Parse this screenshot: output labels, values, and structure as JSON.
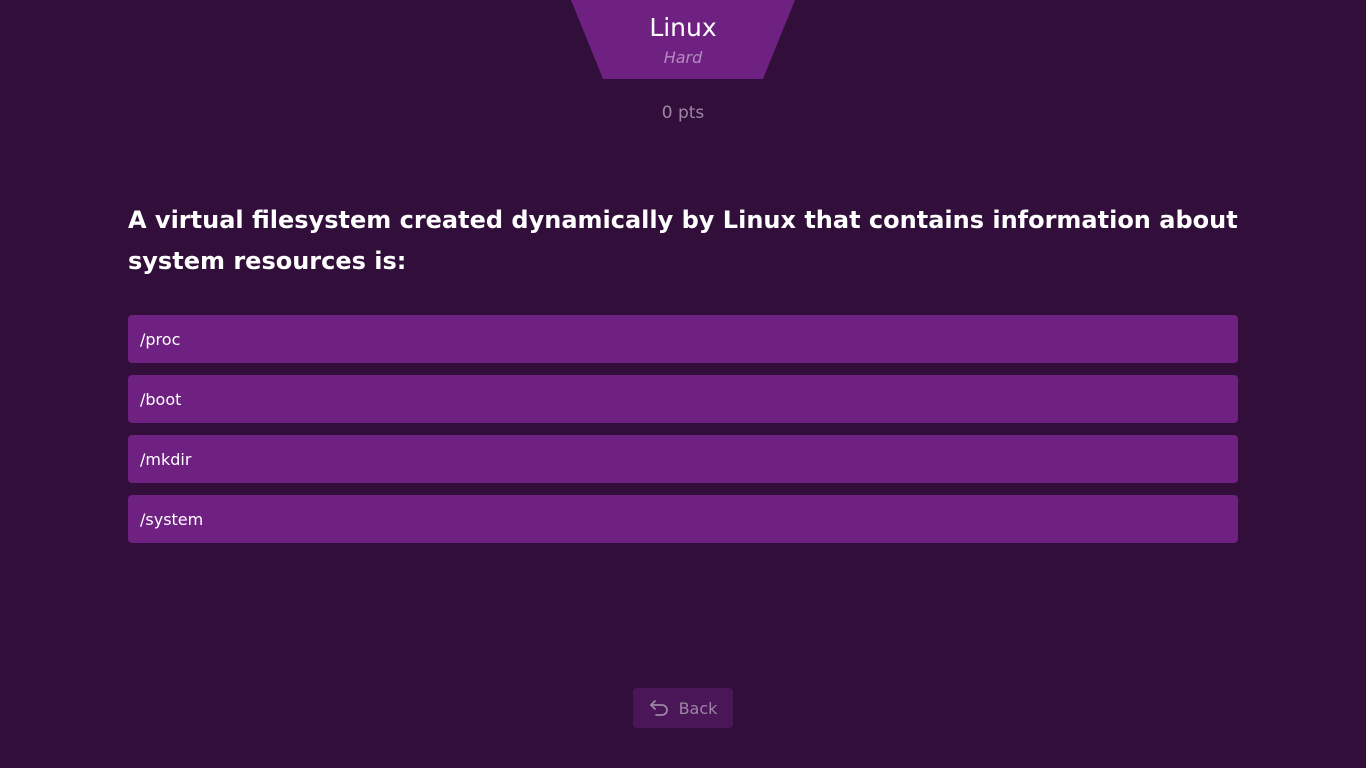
{
  "header": {
    "category": "Linux",
    "difficulty": "Hard"
  },
  "score": {
    "text": "0 pts"
  },
  "question": {
    "text": "A virtual filesystem created dynamically by Linux that contains information about system resources is:"
  },
  "answers": [
    {
      "label": "/proc"
    },
    {
      "label": "/boot"
    },
    {
      "label": "/mkdir"
    },
    {
      "label": "/system"
    }
  ],
  "footer": {
    "back_label": "Back",
    "back_icon": "undo-arrow-icon"
  },
  "colors": {
    "background": "#310f3a",
    "accent": "#6e2180",
    "muted_text": "#9d86a4"
  }
}
